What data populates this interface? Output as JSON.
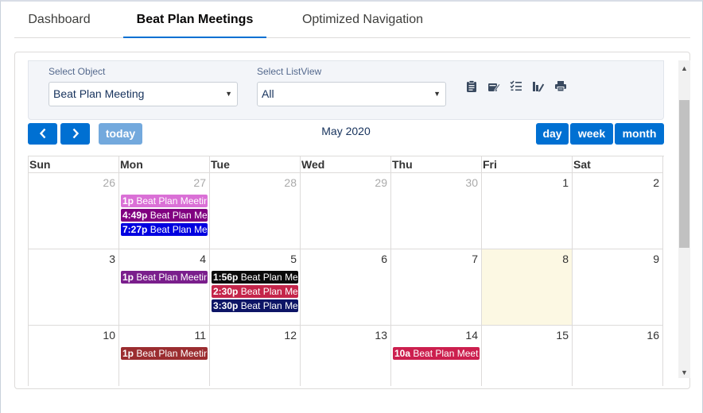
{
  "tabs": [
    "Dashboard",
    "Beat Plan Meetings",
    "Optimized Navigation"
  ],
  "active_tab": "Beat Plan Meetings",
  "filters": {
    "object_label": "Select Object",
    "object_value": "Beat Plan Meeting",
    "listview_label": "Select ListView",
    "listview_value": "All"
  },
  "toolbar_icons": [
    "clipboard-icon",
    "edit-note-icon",
    "checklist-icon",
    "chart-pen-icon",
    "print-icon"
  ],
  "nav": {
    "prev": "‹",
    "next": "›",
    "today": "today"
  },
  "view_buttons": {
    "day": "day",
    "week": "week",
    "month": "month"
  },
  "calendar_title": "May 2020",
  "weekdays": [
    "Sun",
    "Mon",
    "Tue",
    "Wed",
    "Thu",
    "Fri",
    "Sat"
  ],
  "weeks": [
    {
      "days": [
        {
          "num": "26",
          "other": true
        },
        {
          "num": "27",
          "other": true,
          "events": [
            {
              "time": "1p",
              "title": "Beat Plan Meeting",
              "color": "#da70d6"
            },
            {
              "time": "4:49p",
              "title": "Beat Plan Meeting",
              "color": "#800080"
            },
            {
              "time": "7:27p",
              "title": "Beat Plan Meeting",
              "color": "#0000e0"
            }
          ]
        },
        {
          "num": "28",
          "other": true
        },
        {
          "num": "29",
          "other": true
        },
        {
          "num": "30",
          "other": true
        },
        {
          "num": "1"
        },
        {
          "num": "2"
        }
      ]
    },
    {
      "days": [
        {
          "num": "3"
        },
        {
          "num": "4",
          "events": [
            {
              "time": "1p",
              "title": "Beat Plan Meeting",
              "color": "#7a1e8c"
            }
          ]
        },
        {
          "num": "5",
          "events": [
            {
              "time": "1:56p",
              "title": "Beat Plan Meeting",
              "color": "#0a0a0a"
            },
            {
              "time": "2:30p",
              "title": "Beat Plan Meeting",
              "color": "#c4254a"
            },
            {
              "time": "3:30p",
              "title": "Beat Plan Meeting",
              "color": "#0d1566"
            }
          ]
        },
        {
          "num": "6"
        },
        {
          "num": "7"
        },
        {
          "num": "8",
          "today": true
        },
        {
          "num": "9"
        }
      ]
    },
    {
      "days": [
        {
          "num": "10"
        },
        {
          "num": "11",
          "events": [
            {
              "time": "1p",
              "title": "Beat Plan Meeting",
              "color": "#9b2d30"
            }
          ]
        },
        {
          "num": "12"
        },
        {
          "num": "13"
        },
        {
          "num": "14",
          "events": [
            {
              "time": "10a",
              "title": "Beat Plan Meeting",
              "color": "#cc1f4e"
            }
          ]
        },
        {
          "num": "15"
        },
        {
          "num": "16"
        }
      ]
    }
  ]
}
